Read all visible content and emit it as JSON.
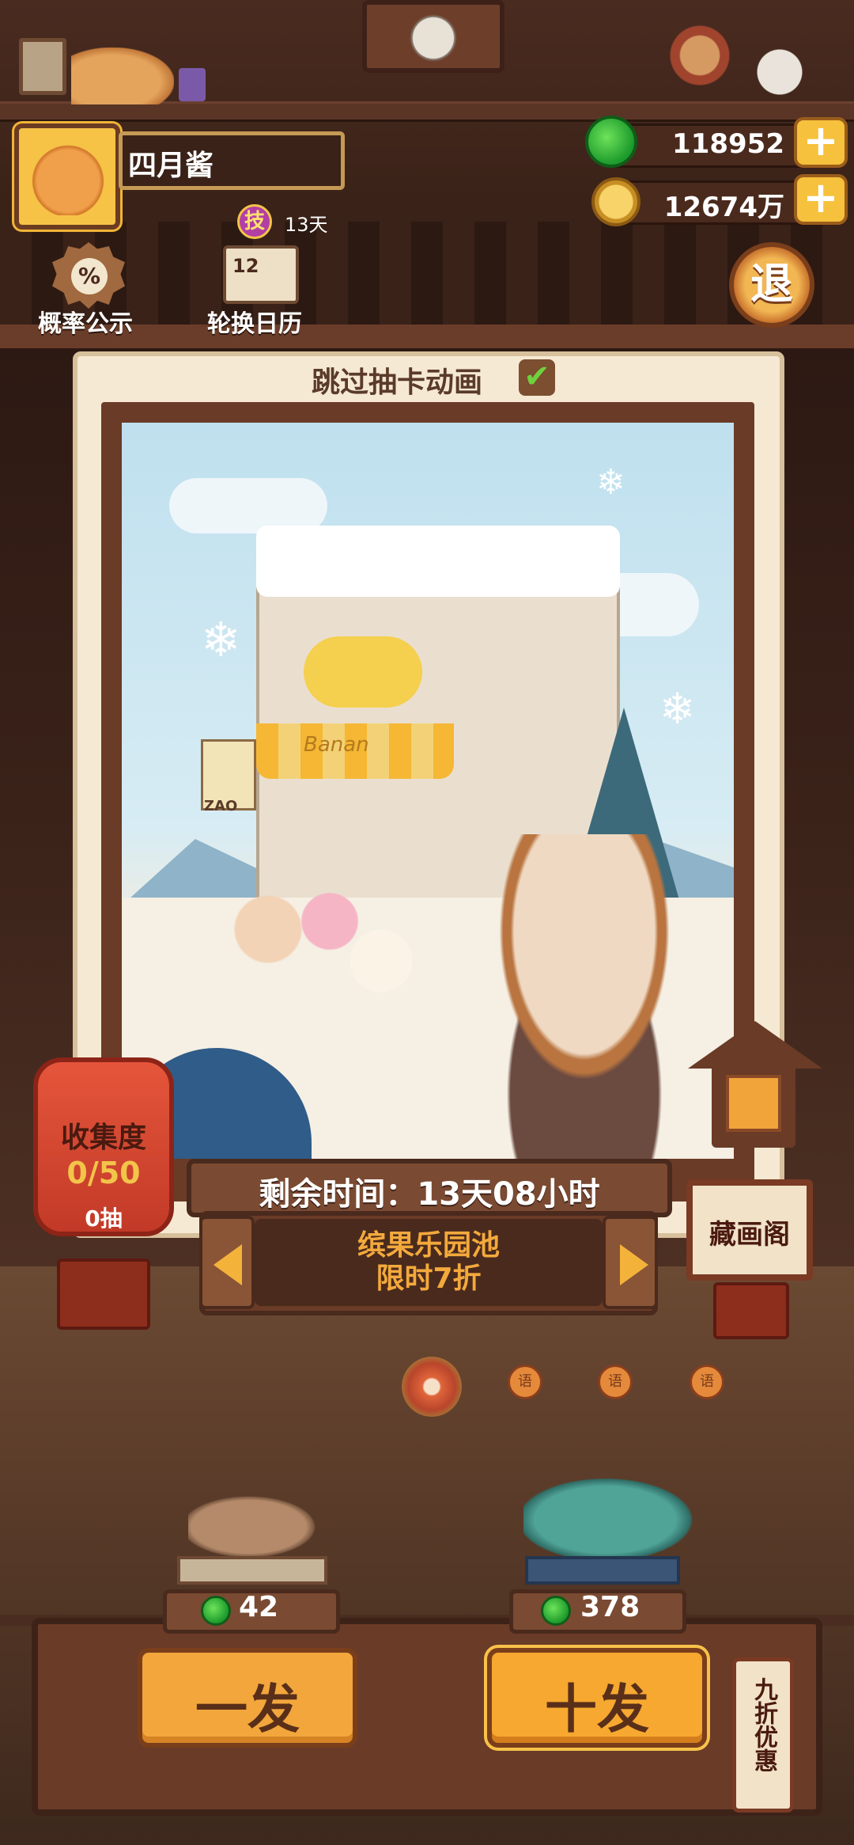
{
  "player": {
    "name": "四月酱",
    "skill_badge": "技",
    "skill_days": "13天"
  },
  "currency": {
    "jade": "118952",
    "coins": "12674万",
    "plus": "+"
  },
  "menu": {
    "rate_label": "概率公示",
    "rate_icon": "%",
    "calendar_label": "轮换日历",
    "calendar_icon": "12",
    "exit_label": "退"
  },
  "panel": {
    "skip_label": "跳过抽卡动画",
    "skip_checked": "✔",
    "art_sign_label": "Banan",
    "art_sign2": "ZAO"
  },
  "collection": {
    "title": "收集度",
    "count": "0/50",
    "pulls": "0抽"
  },
  "pool": {
    "time_remaining": "剩余时间：13天08小时",
    "name": "缤果乐园池",
    "discount": "限时7折"
  },
  "gallery": {
    "label": "藏画阁"
  },
  "page_tags": [
    "语",
    "语",
    "语"
  ],
  "draw": {
    "single_cost": "42",
    "ten_cost": "378",
    "single_label": "一发",
    "ten_label": "十发",
    "discount_tag": "九折优惠"
  },
  "colors": {
    "accent": "#f3a63c",
    "jade": "#1c9a2c",
    "lantern": "#c23a27"
  }
}
